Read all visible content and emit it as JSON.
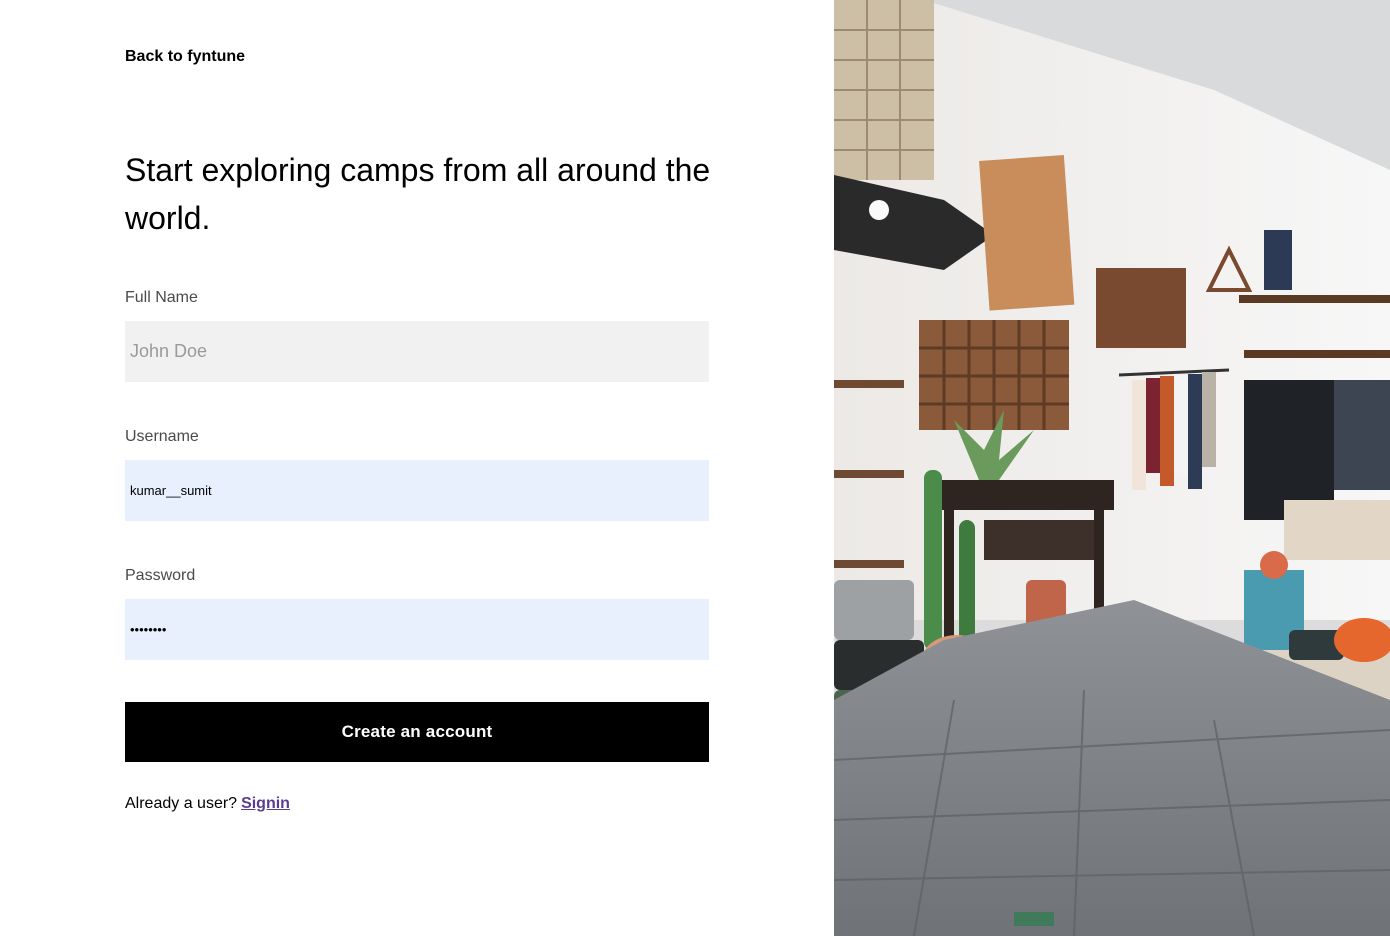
{
  "nav": {
    "back_label": "Back to fyntune"
  },
  "hero": {
    "headline": "Start exploring camps from all around the world."
  },
  "form": {
    "full_name": {
      "label": "Full Name",
      "placeholder": "John Doe",
      "value": ""
    },
    "username": {
      "label": "Username",
      "value": "kumar__sumit"
    },
    "password": {
      "label": "Password",
      "value": "••••••••"
    },
    "submit_label": "Create an account"
  },
  "footer": {
    "prompt": "Already a user?",
    "signin_label": "Signin"
  },
  "colors": {
    "button_bg": "#000000",
    "autofill_bg": "#e8f0fe",
    "input_bg": "#f1f1f1",
    "link": "#5a3d8f"
  }
}
